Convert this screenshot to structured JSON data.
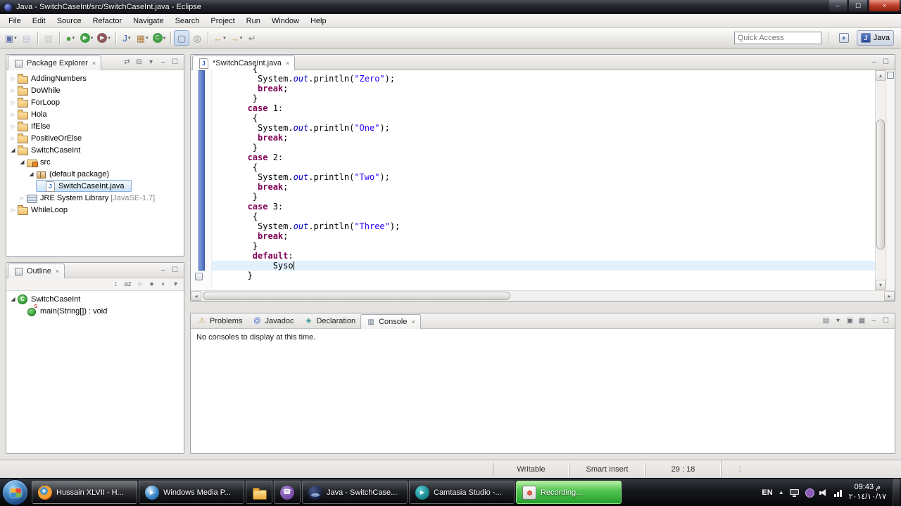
{
  "window": {
    "title": "Java - SwitchCaseInt/src/SwitchCaseInt.java - Eclipse"
  },
  "glyphs": {
    "close": "×",
    "minimize": "–",
    "maximize": "☐",
    "dropdown": "▾",
    "collapsed": "▷",
    "expanded": "◢",
    "overflow": "⋮",
    "tray_expand": "▲",
    "scroll_up": "▴",
    "scroll_down": "▾",
    "scroll_left": "◂",
    "scroll_right": "▸"
  },
  "menubar": {
    "items": [
      "File",
      "Edit",
      "Source",
      "Refactor",
      "Navigate",
      "Search",
      "Project",
      "Run",
      "Window",
      "Help"
    ]
  },
  "toolbar": {
    "quick_access_placeholder": "Quick Access",
    "perspective_label": "Java",
    "icons": [
      {
        "name": "new",
        "glyph": "▣",
        "color": "#5b6ea6",
        "dropdown": true
      },
      {
        "name": "save",
        "glyph": "▤",
        "color": "#8d93c9",
        "disabled": true
      },
      {
        "sep": true
      },
      {
        "name": "print",
        "glyph": "▥",
        "color": "#9a9a9a",
        "disabled": true
      },
      {
        "sep": true
      },
      {
        "name": "debug",
        "glyph": "●",
        "color": "#4f9d3f",
        "dropdown": true
      },
      {
        "name": "run",
        "glyph": "▶",
        "bg": "#43a047",
        "color": "#ffffff",
        "dropdown": true
      },
      {
        "name": "coverage",
        "glyph": "▶",
        "bg": "#8d5a5a",
        "color": "#ffffff",
        "dropdown": true
      },
      {
        "sep": true
      },
      {
        "name": "new-java-project",
        "glyph": "J",
        "color": "#2f5fae",
        "dropdown": true
      },
      {
        "name": "new-package",
        "glyph": "▦",
        "color": "#b07d3f",
        "dropdown": true
      },
      {
        "name": "new-class",
        "glyph": "C",
        "bg": "#43a047",
        "color": "#ffffff",
        "dropdown": true
      },
      {
        "sep": true
      },
      {
        "name": "open-task",
        "glyph": "▢",
        "color": "#6f7b8a",
        "pressed": true
      },
      {
        "name": "search",
        "glyph": "◎",
        "color": "#8a8a8a"
      },
      {
        "sep": true
      },
      {
        "name": "back",
        "glyph": "←",
        "color": "#c9a23c",
        "dropdown": true
      },
      {
        "name": "forward",
        "glyph": "→",
        "color": "#c9a23c",
        "dropdown": true
      },
      {
        "name": "last-edit-location",
        "glyph": "↵",
        "color": "#8a8a8a"
      }
    ]
  },
  "package_explorer": {
    "title": "Package Explorer",
    "header_icons": [
      {
        "name": "link-with-editor",
        "glyph": "⇄"
      },
      {
        "name": "collapse-all",
        "glyph": "⊟"
      },
      {
        "name": "view-menu",
        "glyph": "▾"
      },
      {
        "name": "minimize-view",
        "glyph": "–"
      },
      {
        "name": "maximize-view",
        "glyph": "☐"
      }
    ],
    "tree": [
      {
        "label": "AddingNumbers",
        "level": 0,
        "arrow": "collapsed",
        "icon": "project"
      },
      {
        "label": "DoWhile",
        "level": 0,
        "arrow": "collapsed",
        "icon": "project"
      },
      {
        "label": "ForLoop",
        "level": 0,
        "arrow": "collapsed",
        "icon": "project"
      },
      {
        "label": "Hola",
        "level": 0,
        "arrow": "collapsed",
        "icon": "project"
      },
      {
        "label": "IfElse",
        "level": 0,
        "arrow": "collapsed",
        "icon": "project"
      },
      {
        "label": "PositiveOrElse",
        "level": 0,
        "arrow": "collapsed",
        "icon": "project"
      },
      {
        "label": "SwitchCaseInt",
        "level": 0,
        "arrow": "expanded",
        "icon": "project"
      },
      {
        "label": "src",
        "level": 1,
        "arrow": "expanded",
        "icon": "srcfolder"
      },
      {
        "label": "(default package)",
        "level": 2,
        "arrow": "expanded",
        "icon": "package"
      },
      {
        "label": "SwitchCaseInt.java",
        "level": 3,
        "icon": "jfile",
        "selected": true
      },
      {
        "label": "JRE System Library",
        "suffix": " [JavaSE-1.7]",
        "level": 1,
        "arrow": "collapsed",
        "icon": "library"
      },
      {
        "label": "WhileLoop",
        "level": 0,
        "arrow": "collapsed",
        "icon": "project"
      }
    ]
  },
  "outline": {
    "title": "Outline",
    "header_icons": [
      {
        "name": "minimize-view",
        "glyph": "–"
      },
      {
        "name": "maximize-view",
        "glyph": "☐"
      }
    ],
    "toolbar_icons": [
      {
        "name": "expand-collapse",
        "glyph": "↕"
      },
      {
        "name": "sort-alphabetically",
        "glyph": "az"
      },
      {
        "name": "hide-fields",
        "glyph": "○"
      },
      {
        "name": "hide-static-members",
        "glyph": "●"
      },
      {
        "name": "hide-non-public-members",
        "glyph": "◐"
      },
      {
        "name": "view-menu",
        "glyph": "▾"
      }
    ],
    "tree": [
      {
        "label": "SwitchCaseInt",
        "level": 0,
        "arrow": "expanded",
        "icon": "class"
      },
      {
        "label": "main(String[]) : void",
        "level": 1,
        "icon": "method-static"
      }
    ]
  },
  "editor": {
    "tab_label": "*SwitchCaseInt.java",
    "tabbar_icons": [
      {
        "name": "minimize-view",
        "glyph": "–"
      },
      {
        "name": "maximize-view",
        "glyph": "☐"
      }
    ],
    "code_lines": [
      {
        "tokens": [
          [
            "p",
            "        {"
          ]
        ]
      },
      {
        "tokens": [
          [
            "p",
            "         System."
          ],
          [
            "f",
            "out"
          ],
          [
            "p",
            ".println("
          ],
          [
            "s",
            "\"Zero\""
          ],
          [
            "p",
            ");"
          ]
        ]
      },
      {
        "tokens": [
          [
            "p",
            "         "
          ],
          [
            "k",
            "break"
          ],
          [
            "p",
            ";"
          ]
        ]
      },
      {
        "tokens": [
          [
            "p",
            "        }"
          ]
        ]
      },
      {
        "tokens": [
          [
            "p",
            "       "
          ],
          [
            "k",
            "case"
          ],
          [
            "p",
            " 1:"
          ]
        ]
      },
      {
        "tokens": [
          [
            "p",
            "        {"
          ]
        ]
      },
      {
        "tokens": [
          [
            "p",
            "         System."
          ],
          [
            "f",
            "out"
          ],
          [
            "p",
            ".println("
          ],
          [
            "s",
            "\"One\""
          ],
          [
            "p",
            ");"
          ]
        ]
      },
      {
        "tokens": [
          [
            "p",
            "         "
          ],
          [
            "k",
            "break"
          ],
          [
            "p",
            ";"
          ]
        ]
      },
      {
        "tokens": [
          [
            "p",
            "        }"
          ]
        ]
      },
      {
        "tokens": [
          [
            "p",
            "       "
          ],
          [
            "k",
            "case"
          ],
          [
            "p",
            " 2:"
          ]
        ]
      },
      {
        "tokens": [
          [
            "p",
            "        {"
          ]
        ]
      },
      {
        "tokens": [
          [
            "p",
            "         System."
          ],
          [
            "f",
            "out"
          ],
          [
            "p",
            ".println("
          ],
          [
            "s",
            "\"Two\""
          ],
          [
            "p",
            ");"
          ]
        ]
      },
      {
        "tokens": [
          [
            "p",
            "         "
          ],
          [
            "k",
            "break"
          ],
          [
            "p",
            ";"
          ]
        ]
      },
      {
        "tokens": [
          [
            "p",
            "        }"
          ]
        ]
      },
      {
        "tokens": [
          [
            "p",
            "       "
          ],
          [
            "k",
            "case"
          ],
          [
            "p",
            " 3:"
          ]
        ]
      },
      {
        "tokens": [
          [
            "p",
            "        {"
          ]
        ]
      },
      {
        "tokens": [
          [
            "p",
            "         System."
          ],
          [
            "f",
            "out"
          ],
          [
            "p",
            ".println("
          ],
          [
            "s",
            "\"Three\""
          ],
          [
            "p",
            ");"
          ]
        ]
      },
      {
        "tokens": [
          [
            "p",
            "         "
          ],
          [
            "k",
            "break"
          ],
          [
            "p",
            ";"
          ]
        ]
      },
      {
        "tokens": [
          [
            "p",
            "        }"
          ]
        ]
      },
      {
        "tokens": [
          [
            "p",
            "        "
          ],
          [
            "k",
            "default"
          ],
          [
            "p",
            ":"
          ]
        ]
      },
      {
        "tokens": [
          [
            "p",
            "            Syso"
          ]
        ],
        "current": true,
        "caret": true
      },
      {
        "tokens": [
          [
            "p",
            "       }"
          ]
        ]
      }
    ]
  },
  "console": {
    "tabs": [
      {
        "label": "Problems",
        "glyph": "⚠",
        "color": "#c79a2e"
      },
      {
        "label": "Javadoc",
        "glyph": "@",
        "color": "#3a5acc"
      },
      {
        "label": "Declaration",
        "glyph": "◈",
        "color": "#2e8f8f"
      },
      {
        "label": "Console",
        "glyph": "▥",
        "color": "#5a6a7a",
        "selected": true
      }
    ],
    "toolbar_icons": [
      {
        "name": "open-console",
        "glyph": "▤"
      },
      {
        "name": "open-console-dropdown",
        "glyph": "▾"
      },
      {
        "name": "pin-console",
        "glyph": "▣"
      },
      {
        "name": "display-selected-console",
        "glyph": "▦"
      },
      {
        "name": "minimize-view",
        "glyph": "–"
      },
      {
        "name": "maximize-view",
        "glyph": "☐"
      }
    ],
    "message": "No consoles to display at this time."
  },
  "statusbar": {
    "writable": "Writable",
    "insert_mode": "Smart Insert",
    "caret_position": "29 : 18"
  },
  "taskbar": {
    "buttons": [
      {
        "name": "firefox",
        "icon": "firefox",
        "label": "Hussain XLVII - H...",
        "style": "lit"
      },
      {
        "name": "windows-media-player",
        "icon": "wmp",
        "label": "Windows Media P..."
      },
      {
        "name": "explorer",
        "icon": "folder"
      },
      {
        "name": "viber",
        "icon": "viber"
      },
      {
        "name": "eclipse",
        "icon": "eclipse",
        "label": "Java - SwitchCase..."
      },
      {
        "name": "camtasia",
        "icon": "camtasia",
        "label": "Camtasia Studio -..."
      },
      {
        "name": "recording",
        "icon": "recdot",
        "label": "Recording...",
        "style": "rec"
      }
    ],
    "tray": {
      "language": "EN",
      "time": "09:43 م",
      "date": "٢٠١٤/١٠/١٧"
    }
  }
}
